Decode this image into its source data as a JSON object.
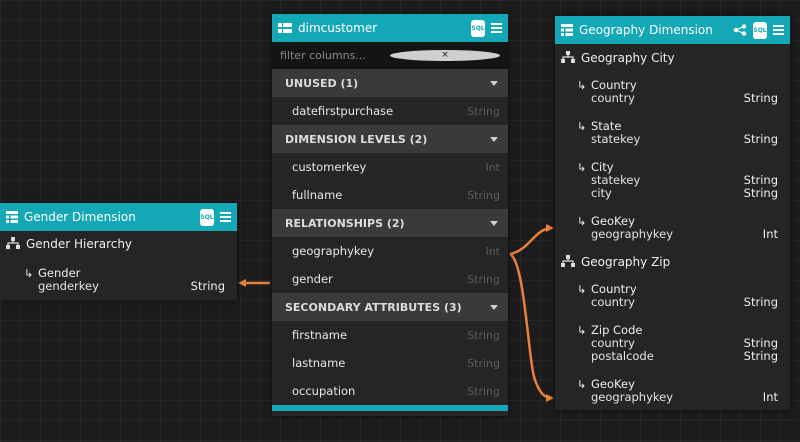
{
  "dimcustomer": {
    "title": "dimcustomer",
    "sql_label": "SQL",
    "filter_placeholder": "filter columns...",
    "sections": [
      {
        "label": "UNUSED (1)",
        "columns": [
          {
            "name": "datefirstpurchase",
            "type": "String"
          }
        ]
      },
      {
        "label": "DIMENSION LEVELS (2)",
        "columns": [
          {
            "name": "customerkey",
            "type": "Int"
          },
          {
            "name": "fullname",
            "type": "String"
          }
        ]
      },
      {
        "label": "RELATIONSHIPS (2)",
        "columns": [
          {
            "name": "geographykey",
            "type": "Int"
          },
          {
            "name": "gender",
            "type": "String"
          }
        ]
      },
      {
        "label": "SECONDARY ATTRIBUTES (3)",
        "columns": [
          {
            "name": "firstname",
            "type": "String"
          },
          {
            "name": "lastname",
            "type": "String"
          },
          {
            "name": "occupation",
            "type": "String"
          }
        ]
      }
    ]
  },
  "gender_dimension": {
    "title": "Gender Dimension",
    "sql_label": "SQL",
    "hierarchy": "Gender Hierarchy",
    "level": {
      "name": "Gender",
      "key": "genderkey",
      "type": "String"
    }
  },
  "geography_dimension": {
    "title": "Geography Dimension",
    "sql_label": "SQL",
    "hierarchies": [
      {
        "name": "Geography City",
        "levels": [
          {
            "name": "Country",
            "rows": [
              {
                "key": "country",
                "type": "String"
              }
            ]
          },
          {
            "name": "State",
            "rows": [
              {
                "key": "statekey",
                "type": "String"
              }
            ]
          },
          {
            "name": "City",
            "rows": [
              {
                "key": "statekey",
                "type": "String"
              },
              {
                "key": "city",
                "type": "String"
              }
            ]
          },
          {
            "name": "GeoKey",
            "rows": [
              {
                "key": "geographykey",
                "type": "Int"
              }
            ]
          }
        ]
      },
      {
        "name": "Geography Zip",
        "levels": [
          {
            "name": "Country",
            "rows": [
              {
                "key": "country",
                "type": "String"
              }
            ]
          },
          {
            "name": "Zip Code",
            "rows": [
              {
                "key": "country",
                "type": "String"
              },
              {
                "key": "postalcode",
                "type": "String"
              }
            ]
          },
          {
            "name": "GeoKey",
            "rows": [
              {
                "key": "geographykey",
                "type": "Int"
              }
            ]
          }
        ]
      }
    ]
  },
  "colors": {
    "accent": "#14a7b5",
    "link": "#e8813a",
    "panel": "#252525",
    "section": "#3a3a3a"
  },
  "icons": [
    "table-icon",
    "menu-icon",
    "sql-icon",
    "hierarchy-icon",
    "level-arrow-icon",
    "link-icon",
    "caret-down-icon",
    "clear-icon"
  ]
}
